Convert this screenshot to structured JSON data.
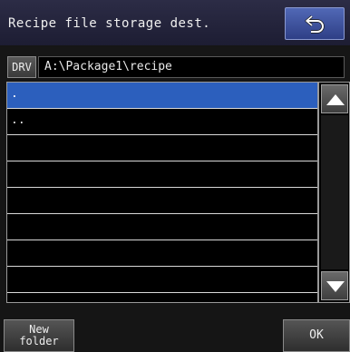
{
  "header": {
    "title": "Recipe file storage dest.",
    "back_icon": "return-arrow-icon"
  },
  "path": {
    "drive_label": "DRV",
    "current_path": "A:\\Package1\\recipe"
  },
  "file_list": {
    "items": [
      ".",
      "..",
      "",
      "",
      "",
      "",
      "",
      ""
    ],
    "selected_index": 0
  },
  "scrollbar": {
    "up_icon": "triangle-up-icon",
    "down_icon": "triangle-down-icon"
  },
  "buttons": {
    "new_folder_line1": "New",
    "new_folder_line2": "folder",
    "ok": "OK"
  },
  "colors": {
    "selection": "#2c5fbd",
    "header_bg": "#24243c",
    "accent_button": "#3e54a0"
  }
}
